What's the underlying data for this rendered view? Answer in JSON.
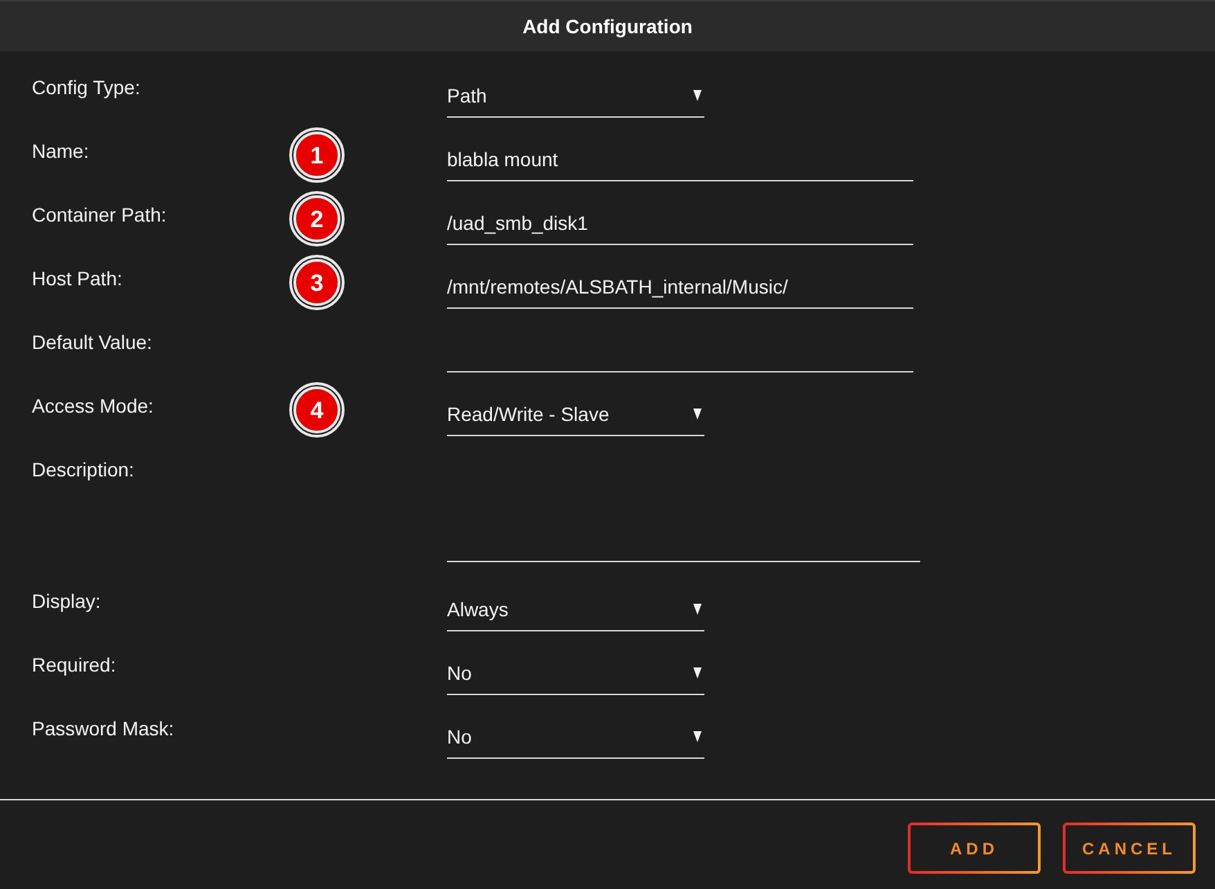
{
  "dialog": {
    "title": "Add Configuration"
  },
  "fields": [
    {
      "label": "Config Type:",
      "kind": "select",
      "value": "Path"
    },
    {
      "label": "Name:",
      "kind": "text",
      "value": "blabla mount",
      "marker": "1"
    },
    {
      "label": "Container Path:",
      "kind": "text",
      "value": "/uad_smb_disk1",
      "marker": "2"
    },
    {
      "label": "Host Path:",
      "kind": "text",
      "value": "/mnt/remotes/ALSBATH_internal/Music/",
      "marker": "3"
    },
    {
      "label": "Default Value:",
      "kind": "text"
    },
    {
      "label": "Access Mode:",
      "kind": "select",
      "value": "Read/Write - Slave",
      "marker": "4"
    },
    {
      "label": "Description:",
      "kind": "textarea"
    },
    {
      "label": "Display:",
      "kind": "select",
      "value": "Always"
    },
    {
      "label": "Required:",
      "kind": "select",
      "value": "No"
    },
    {
      "label": "Password Mask:",
      "kind": "select",
      "value": "No"
    }
  ],
  "buttons": [
    {
      "label": "ADD"
    },
    {
      "label": "CANCEL"
    }
  ]
}
